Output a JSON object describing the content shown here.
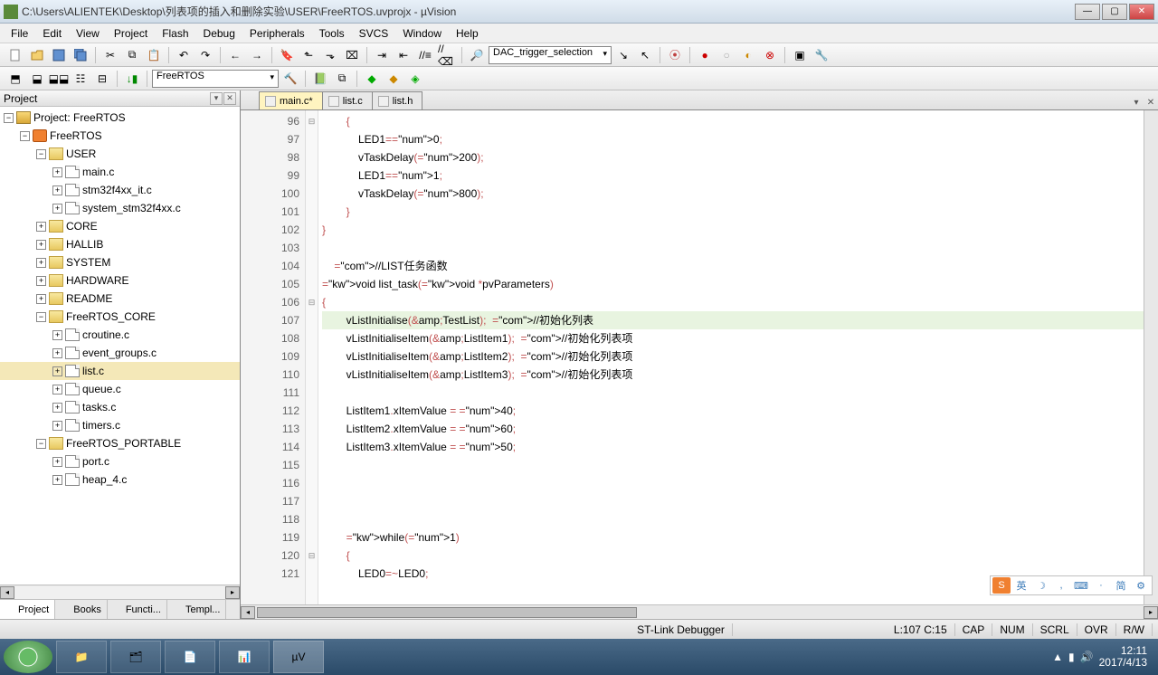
{
  "window": {
    "title": "C:\\Users\\ALIENTEK\\Desktop\\列表项的插入和删除实验\\USER\\FreeRTOS.uvprojx - µVision"
  },
  "menu": [
    "File",
    "Edit",
    "View",
    "Project",
    "Flash",
    "Debug",
    "Peripherals",
    "Tools",
    "SVCS",
    "Window",
    "Help"
  ],
  "toolbar": {
    "combo1": "DAC_trigger_selection",
    "target": "FreeRTOS"
  },
  "project": {
    "panel_title": "Project",
    "root": "Project: FreeRTOS",
    "target": "FreeRTOS",
    "groups": [
      {
        "name": "USER",
        "expanded": true,
        "files": [
          "main.c",
          "stm32f4xx_it.c",
          "system_stm32f4xx.c"
        ]
      },
      {
        "name": "CORE",
        "expanded": false,
        "files": []
      },
      {
        "name": "HALLIB",
        "expanded": false,
        "files": []
      },
      {
        "name": "SYSTEM",
        "expanded": false,
        "files": []
      },
      {
        "name": "HARDWARE",
        "expanded": false,
        "files": []
      },
      {
        "name": "README",
        "expanded": false,
        "files": []
      },
      {
        "name": "FreeRTOS_CORE",
        "expanded": true,
        "files": [
          "croutine.c",
          "event_groups.c",
          "list.c",
          "queue.c",
          "tasks.c",
          "timers.c"
        ]
      },
      {
        "name": "FreeRTOS_PORTABLE",
        "expanded": true,
        "files": [
          "port.c",
          "heap_4.c"
        ]
      }
    ],
    "tabs": [
      "Project",
      "Books",
      "Functi...",
      "Templ..."
    ],
    "selected_file": "list.c"
  },
  "editor": {
    "tabs": [
      {
        "label": "main.c*",
        "active": true
      },
      {
        "label": "list.c",
        "active": false
      },
      {
        "label": "list.h",
        "active": false
      }
    ],
    "first_line": 96,
    "current_line": 107,
    "lines": [
      "        {",
      "            LED1=0;",
      "            vTaskDelay(200);",
      "            LED1=1;",
      "            vTaskDelay(800);",
      "        }",
      "}",
      "",
      "    //LIST任务函数",
      "void list_task(void *pvParameters)",
      "{",
      "        vListInitialise(&TestList);  //初始化列表",
      "        vListInitialiseItem(&ListItem1);  //初始化列表项",
      "        vListInitialiseItem(&ListItem2);  //初始化列表项",
      "        vListInitialiseItem(&ListItem3);  //初始化列表项",
      "",
      "        ListItem1.xItemValue = 40;",
      "        ListItem2.xItemValue = 60;",
      "        ListItem3.xItemValue = 50;",
      "",
      "",
      "",
      "",
      "        while(1)",
      "        {",
      "            LED0=~LED0;"
    ]
  },
  "status": {
    "debugger": "ST-Link Debugger",
    "pos": "L:107 C:15",
    "caps": "CAP",
    "num": "NUM",
    "scrl": "SCRL",
    "ovr": "OVR",
    "rw": "R/W"
  },
  "ime": {
    "buttons": [
      "英",
      ",",
      "·",
      "简"
    ]
  },
  "clock": {
    "time": "12:11",
    "date": "2017/4/13"
  }
}
